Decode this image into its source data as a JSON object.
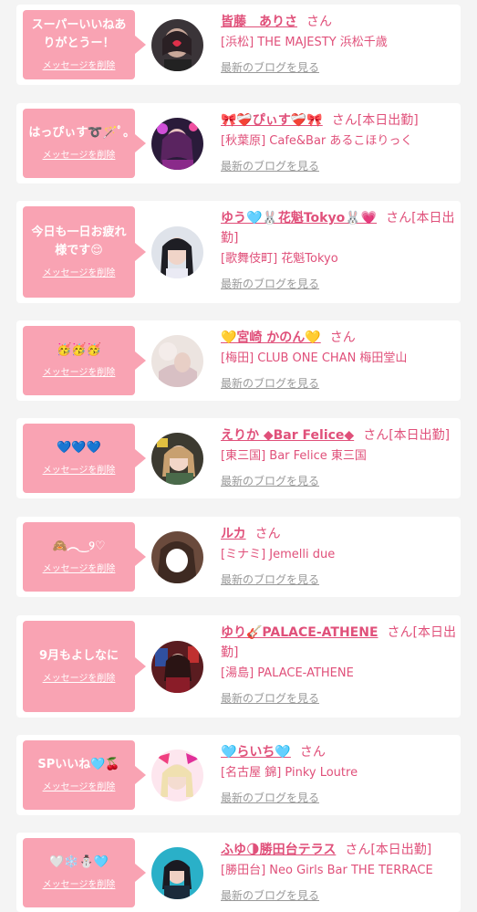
{
  "delete_label": "メッセージを削除",
  "blog_label": "最新のブログを見る",
  "honorific": "さん",
  "colors": {
    "accent": "#e0507a",
    "bubble": "#f9a3b3",
    "link_gray": "#999999"
  },
  "items": [
    {
      "message": "スーパーいいねありがとうー！",
      "name": "皆藤　ありさ",
      "status": "",
      "store": "[浜松] THE MAJESTY 浜松千歳"
    },
    {
      "message": "はっぴぃす➰🪄ﾟ｡",
      "name": "🎀❤️‍🩹ぴぃす❤️‍🩹🎀",
      "status": "[本日出勤]",
      "store": "[秋葉原] Cafe&Bar あるこほりっく"
    },
    {
      "message": "今日も一日お疲れ様です😌",
      "name": "ゆう🩵🐰花魁Tokyo🐰💗",
      "status": "[本日出勤]",
      "store": "[歌舞伎町] 花魁Tokyo"
    },
    {
      "message": "🥳🥳🥳",
      "name": "💛宮崎 かのん💛",
      "status": "",
      "store": "[梅田] CLUB ONE CHAN 梅田堂山"
    },
    {
      "message": "💙💙💙",
      "name": "えりか ◆Bar Felice◆",
      "status": "[本日出勤]",
      "store": "[東三国] Bar Felice 東三国"
    },
    {
      "message": "🙈︵‿୨♡",
      "name": "ルカ",
      "status": "",
      "store": "[ミナミ] Jemelli due"
    },
    {
      "message": "9月もよしなに",
      "name": "ゆり🎸PALACE-ATHENE",
      "status": "[本日出勤]",
      "store": "[湯島] PALACE-ATHENE"
    },
    {
      "message": "SPいいね🩵🍒",
      "name": "🩵らいち🩵",
      "status": "",
      "store": "[名古屋 錦] Pinky Loutre"
    },
    {
      "message": "🤍❄️⛄️🩵",
      "name": "ふゆ🌗勝田台テラス",
      "status": "[本日出勤]",
      "store": "[勝田台] Neo Girls Bar THE TERRACE"
    }
  ]
}
